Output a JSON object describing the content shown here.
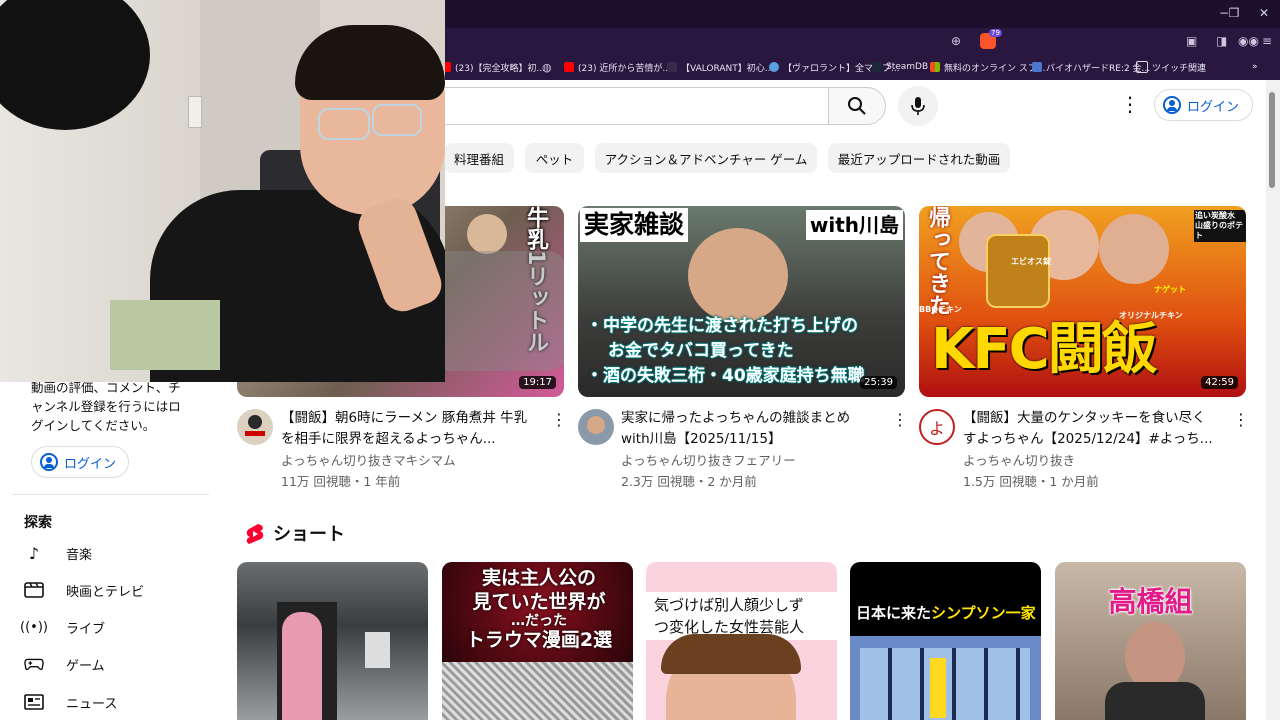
{
  "browser": {
    "window_controls": [
      "−",
      "❐",
      "✕"
    ],
    "bookmarks": [
      {
        "label": "(23)【完全攻略】初...",
        "color": "#ff0000"
      },
      {
        "label": "(23) 近所から苦情が...",
        "color": "#ff0000"
      },
      {
        "label": "【VALORANT】初心...",
        "color": "#3a2a4a"
      },
      {
        "label": "【ヴァロラント】全マップ...",
        "color": "#5aa0e0"
      },
      {
        "label": "SteamDB",
        "color": "#1b2838"
      },
      {
        "label": "無料のオンライン スプ...",
        "color": "#2e9e4f"
      },
      {
        "label": "バイオハザードRE:2 金...",
        "color": "#4a78d0"
      },
      {
        "label": "ツイッチ関連",
        "color": "#e0d8ea"
      }
    ],
    "brave_badge": "79"
  },
  "header": {
    "search_placeholder": "",
    "login_label": "ログイン"
  },
  "chips": [
    "料理番組",
    "ペット",
    "アクション＆アドベンチャー ゲーム",
    "最近アップロードされた動画"
  ],
  "videos": [
    {
      "thumb_overlay": "牛乳1リットル",
      "duration": "19:17",
      "title_line1": "【闘飯】朝6時にラーメン 豚角煮丼 牛乳",
      "title_line2": "を相手に限界を超えるよっちゃん...",
      "channel": "よっちゃん切り抜きマキシマム",
      "meta": "11万 回視聴・1 年前"
    },
    {
      "thumb_top": "実家雑談",
      "thumb_top_right": "with川島",
      "thumb_line1": "・中学の先生に渡された打ち上げの",
      "thumb_line2": "お金でタバコ買ってきた",
      "thumb_line3": "・酒の失敗三桁・40歳家庭持ち無職",
      "duration": "25:39",
      "title_line1": "実家に帰ったよっちゃんの雑談まとめ",
      "title_line2": "with川島【2025/11/15】",
      "channel": "よっちゃん切り抜きフェアリー",
      "meta": "2.3万 回視聴・2 か月前"
    },
    {
      "thumb_left": "帰ってきた",
      "thumb_big": "KFC闘飯",
      "thumb_label1": "BBQチキン",
      "thumb_label2": "エビオス錠",
      "thumb_label3": "オリジナルチキン",
      "thumb_label4": "ナゲット",
      "thumb_label5": "追い炭酸水 山盛りのポテト",
      "duration": "42:59",
      "avatar_char": "よ",
      "title_line1": "【闘飯】大量のケンタッキーを食い尽く",
      "title_line2": "すよっちゃん【2025/12/24】#よっち...",
      "channel": "よっちゃん切り抜き",
      "meta": "1.5万 回視聴・1 か月前"
    }
  ],
  "sidebar": {
    "login_text": "動画の評価、コメント、チャンネル登録を行うにはログインしてください。",
    "login_label": "ログイン",
    "section_title": "探索",
    "items": [
      {
        "label": "音楽",
        "icon": "music-note-icon"
      },
      {
        "label": "映画とテレビ",
        "icon": "film-icon"
      },
      {
        "label": "ライブ",
        "icon": "live-icon"
      },
      {
        "label": "ゲーム",
        "icon": "gamepad-icon"
      },
      {
        "label": "ニュース",
        "icon": "news-icon"
      }
    ]
  },
  "shorts": {
    "title": "ショート",
    "items": [
      {
        "text": ""
      },
      {
        "text_line1": "実は主人公の",
        "text_line2": "見ていた世界が",
        "text_line3": "…だった",
        "text_line4": "トラウマ漫画2選"
      },
      {
        "text_line1": "気づけば別人顔少しず",
        "text_line2": "つ変化した女性芸能人"
      },
      {
        "text_pre": "日本に来た",
        "text_hl": "シンプソン一家"
      },
      {
        "text_line1": "高橋組"
      }
    ]
  },
  "colors": {
    "accent_blue": "#065fd4",
    "chrome_purple": "#2a1740",
    "yt_red": "#ff0033"
  }
}
